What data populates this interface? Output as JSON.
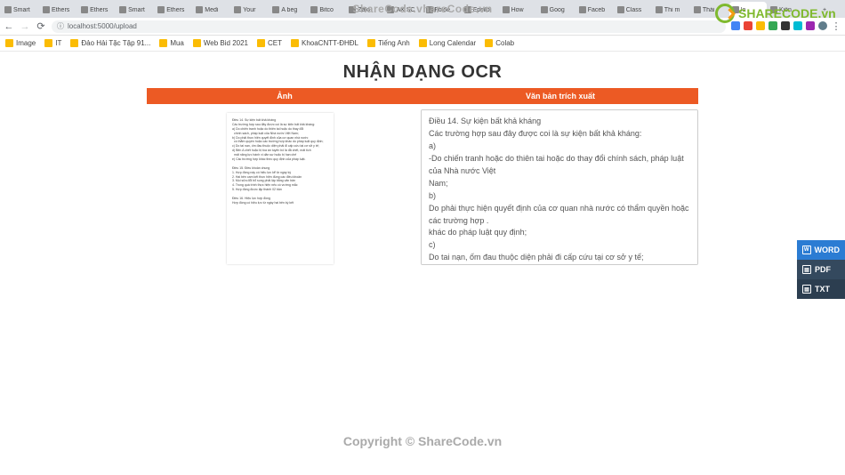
{
  "tabs": [
    {
      "t": "Smart"
    },
    {
      "t": "Ethers"
    },
    {
      "t": "Ethers"
    },
    {
      "t": "Smart"
    },
    {
      "t": "Ethers"
    },
    {
      "t": "Medi"
    },
    {
      "t": "Your"
    },
    {
      "t": "A beg"
    },
    {
      "t": "Bitco"
    },
    {
      "t": "Zalo"
    },
    {
      "t": "AX SC"
    },
    {
      "t": "Folde"
    },
    {
      "t": "Epsilo"
    },
    {
      "t": "How"
    },
    {
      "t": "Goog"
    },
    {
      "t": "Faceb"
    },
    {
      "t": "Class"
    },
    {
      "t": "Thi m"
    },
    {
      "t": "Thái"
    },
    {
      "t": "lo",
      "active": true
    },
    {
      "t": "Kiến"
    }
  ],
  "url": "localhost:5000/upload",
  "bookmarks": [
    "Image",
    "IT",
    "Đảo Hải Tặc Tập 91...",
    "Mua",
    "Web Bid 2021",
    "CET",
    "KhoaCNTT-ĐHĐL",
    "Tiếng Anh",
    "Long Calendar",
    "Colab"
  ],
  "page_title": "NHẬN DẠNG OCR",
  "col_image": "Ảnh",
  "col_text": "Văn bản trích xuất",
  "ocr_text": "Điều 14. Sự kiện bất khả kháng\nCác trường hợp sau đây được coi là sự kiện bất khả kháng:\na)\n-Do chiến tranh hoặc do thiên tai hoặc do thay đổi chính sách, pháp luật của Nhà nước Việt\nNam;\nb)\nDo phải thực hiện quyết định của cơ quan nhà nước có thẩm quyền hoặc các trường hợp .\nkhác do pháp luật quy định;\nc)\nDo tai nạn, ốm đau thuộc diện phải đi cấp cứu tại cơ sở y tế;",
  "side": {
    "word": "WORD",
    "pdf": "PDF",
    "txt": "TXT"
  },
  "wm_center": "ShareCode.vhareCode.vn",
  "wm_footer": "Copyright © ShareCode.vn",
  "wm_logo_text": "SHARECODE.vn"
}
